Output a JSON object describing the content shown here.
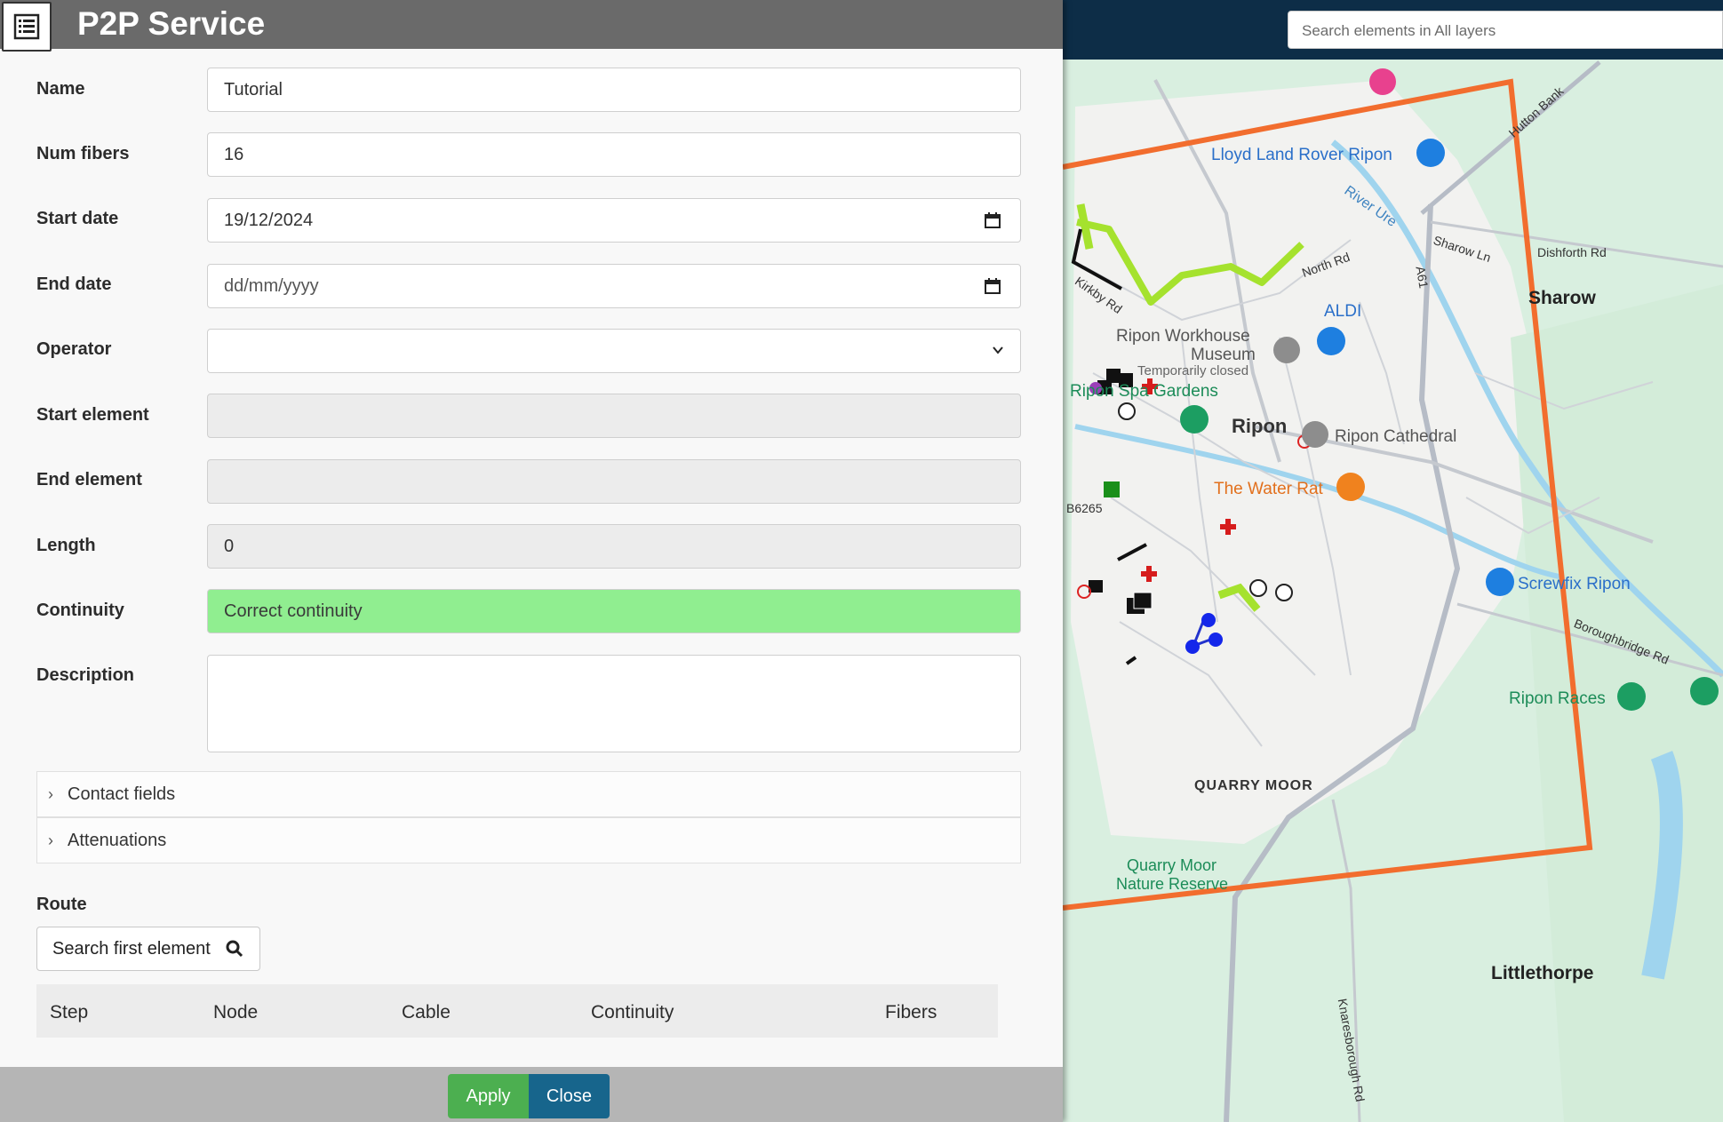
{
  "panel": {
    "title": "P2P Service",
    "fields": {
      "name": {
        "label": "Name",
        "value": "Tutorial"
      },
      "num_fibers": {
        "label": "Num fibers",
        "value": "16"
      },
      "start_date": {
        "label": "Start date",
        "value": "19/12/2024"
      },
      "end_date": {
        "label": "End date",
        "placeholder": "dd/mm/yyyy"
      },
      "operator": {
        "label": "Operator",
        "value": ""
      },
      "start_element": {
        "label": "Start element",
        "value": ""
      },
      "end_element": {
        "label": "End element",
        "value": ""
      },
      "length": {
        "label": "Length",
        "value": "0"
      },
      "continuity": {
        "label": "Continuity",
        "value": "Correct continuity"
      },
      "description": {
        "label": "Description",
        "value": ""
      }
    },
    "accordions": [
      {
        "label": "Contact fields"
      },
      {
        "label": "Attenuations"
      }
    ],
    "route": {
      "label": "Route",
      "search_button": "Search first element",
      "columns": [
        "Step",
        "Node",
        "Cable",
        "Continuity",
        "Fibers"
      ]
    },
    "buttons": {
      "apply": "Apply",
      "close": "Close"
    }
  },
  "map": {
    "search_placeholder": "Search elements in All layers",
    "labels": {
      "lloyd": "Lloyd Land Rover Ripon",
      "river": "River Ure",
      "sharow": "Sharow",
      "sharow_ln": "Sharow Ln",
      "dishforth": "Dishforth Rd",
      "hutton": "Hutton Bank",
      "north_rd": "North Rd",
      "kirkby": "Kirkby Rd",
      "aldi": "ALDI",
      "workhouse": "Ripon Workhouse",
      "museum": "Museum",
      "temp_closed": "Temporarily closed",
      "spa": "Ripon Spa Gardens",
      "ripon": "Ripon",
      "cathedral": "Ripon Cathedral",
      "water_rat": "The Water Rat",
      "screwfix": "Screwfix Ripon",
      "boroughbridge": "Boroughbridge Rd",
      "b6265": "B6265",
      "racecourse": "Ripon Races",
      "quarry_moor": "QUARRY MOOR",
      "reserve_1": "Quarry Moor",
      "reserve_2": "Nature Reserve",
      "littlethorpe": "Littlethorpe",
      "knaresborough": "Knaresborough Rd",
      "a61": "A61"
    },
    "colors": {
      "boundary": "#f26d2e",
      "route": "#a5e22e",
      "water": "#9fd4ee"
    }
  }
}
